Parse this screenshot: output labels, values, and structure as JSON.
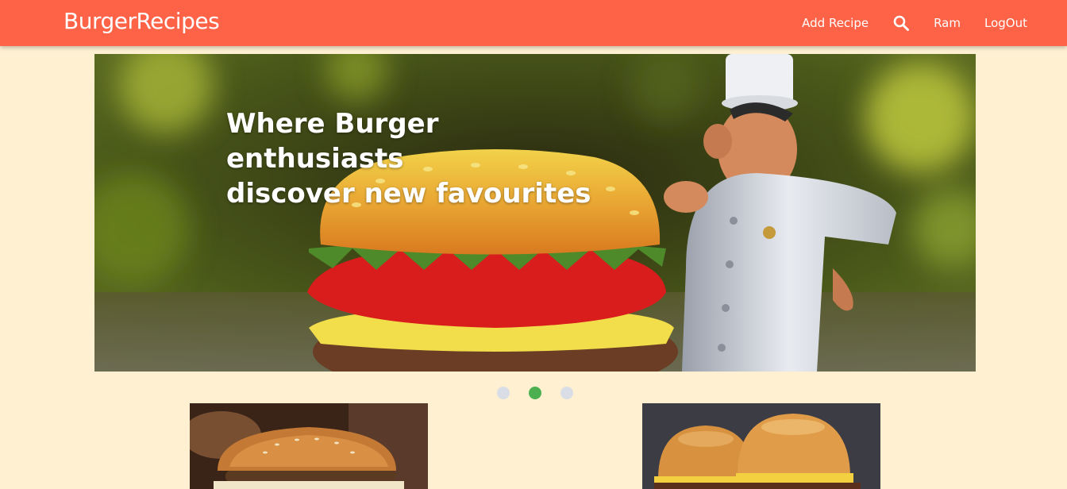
{
  "navbar": {
    "brand": "BurgerRecipes",
    "links": {
      "add_recipe": "Add Recipe",
      "user": "Ram",
      "logout": "LogOut"
    },
    "color": "#ff6347",
    "search_icon": "search-icon"
  },
  "hero": {
    "caption_line1": "Where Burger enthusiasts",
    "caption_line2": "discover new favourites",
    "active_slide": 2,
    "slide_count": 3
  },
  "colors": {
    "page_background": "#fff0d2",
    "active_dot": "#4caf50",
    "inactive_dot": "#d9dde6"
  }
}
